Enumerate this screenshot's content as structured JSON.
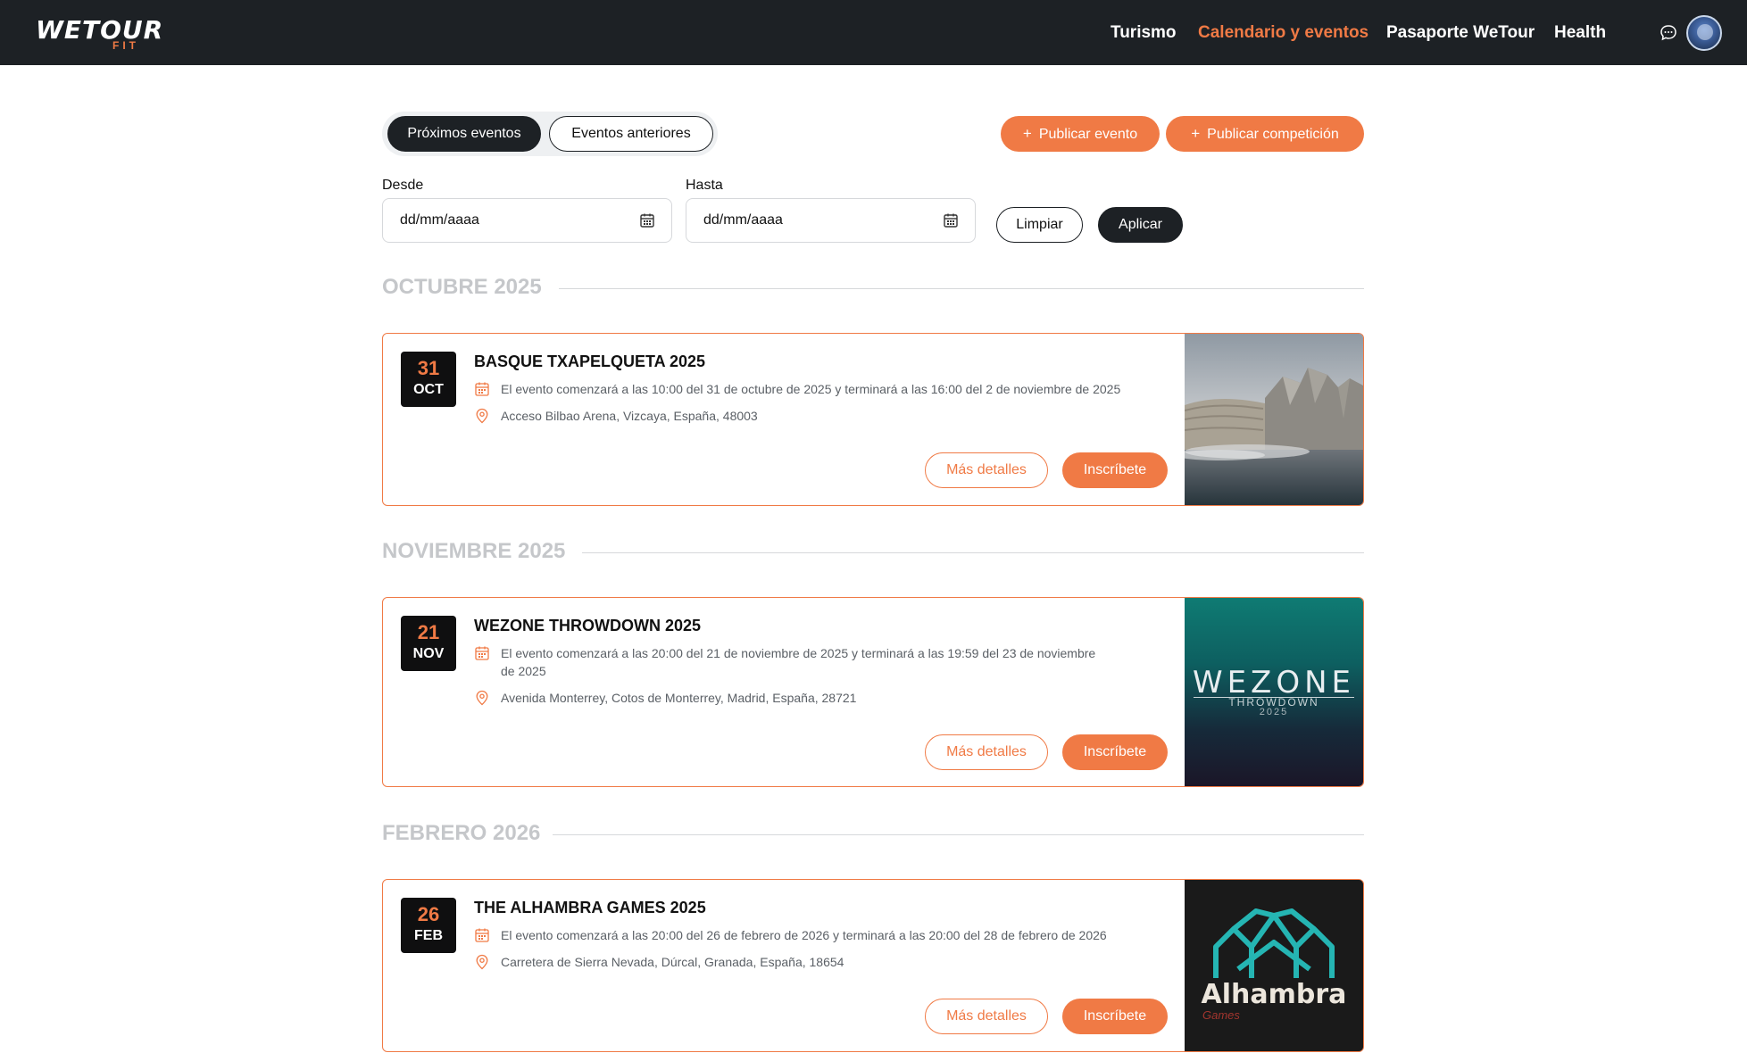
{
  "brand": {
    "logo_main": "WETOUR",
    "logo_sub": "FIT"
  },
  "nav": {
    "items": [
      "Turismo",
      "Calendario y eventos",
      "Pasaporte WeTour",
      "Health"
    ],
    "active_index": 1
  },
  "toggle": {
    "upcoming": "Próximos eventos",
    "past": "Eventos anteriores"
  },
  "actions": {
    "publish_event": "Publicar evento",
    "publish_competition": "Publicar competición",
    "plus": "+"
  },
  "filters": {
    "from_label": "Desde",
    "to_label": "Hasta",
    "from_placeholder": "dd/mm/aaaa",
    "to_placeholder": "dd/mm/aaaa",
    "clear": "Limpiar",
    "apply": "Aplicar"
  },
  "months": [
    "OCTUBRE 2025",
    "NOVIEMBRE 2025",
    "FEBRERO 2026"
  ],
  "events": [
    {
      "day": "31",
      "mon": "OCT",
      "title": "BASQUE TXAPELQUETA 2025",
      "schedule": "El evento comenzará a las 10:00 del 31 de octubre de 2025 y terminará a las 16:00 del 2 de noviembre de 2025",
      "location": "Acceso Bilbao Arena, Vizcaya, España, 48003",
      "more": "Más detalles",
      "signup": "Inscríbete"
    },
    {
      "day": "21",
      "mon": "NOV",
      "title": "WEZONE THROWDOWN 2025",
      "schedule_line1": "El evento comenzará a las 20:00 del 21 de noviembre de 2025 y terminará a las 19:59 del 23 de noviembre",
      "schedule_line2": "de 2025",
      "location": "Avenida Monterrey, Cotos de Monterrey, Madrid, España, 28721",
      "more": "Más detalles",
      "signup": "Inscríbete",
      "image_text": {
        "main": "WEZONE",
        "sub": "THROWDOWN",
        "year": "2025"
      }
    },
    {
      "day": "26",
      "mon": "FEB",
      "title": "THE ALHAMBRA GAMES 2025",
      "schedule": "El evento comenzará a las 20:00 del 26 de febrero de 2026 y terminará a las 20:00 del 28 de febrero de 2026",
      "location": "Carretera de Sierra Nevada, Dúrcal, Granada, España, 18654",
      "more": "Más detalles",
      "signup": "Inscríbete",
      "image_text": {
        "main": "Alhambra",
        "sub": "Games"
      }
    }
  ],
  "colors": {
    "accent": "#f07a45",
    "dark": "#1d2125",
    "muted": "#c5c7ca"
  }
}
